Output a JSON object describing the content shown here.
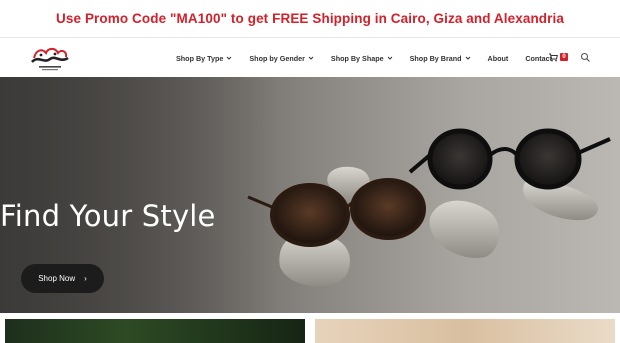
{
  "promo": {
    "text": "Use Promo Code \"MA100\" to get FREE Shipping in Cairo, Giza and Alexandria"
  },
  "nav": {
    "items": [
      {
        "label": "Shop By Type",
        "has_dropdown": true
      },
      {
        "label": "Shop by Gender",
        "has_dropdown": true
      },
      {
        "label": "Shop By Shape",
        "has_dropdown": true
      },
      {
        "label": "Shop By Brand",
        "has_dropdown": true
      },
      {
        "label": "About",
        "has_dropdown": false
      },
      {
        "label": "Contact",
        "has_dropdown": false
      }
    ],
    "cart_count": "0",
    "icons": {
      "cart": "cart-icon",
      "search": "search-icon",
      "dropdown": "chevron-down-icon"
    }
  },
  "hero": {
    "title": "Find Your Style",
    "button_label": "Shop Now"
  },
  "colors": {
    "promo_red": "#d4202a",
    "nav_text": "#333333",
    "button_bg": "#1c1c1c"
  }
}
